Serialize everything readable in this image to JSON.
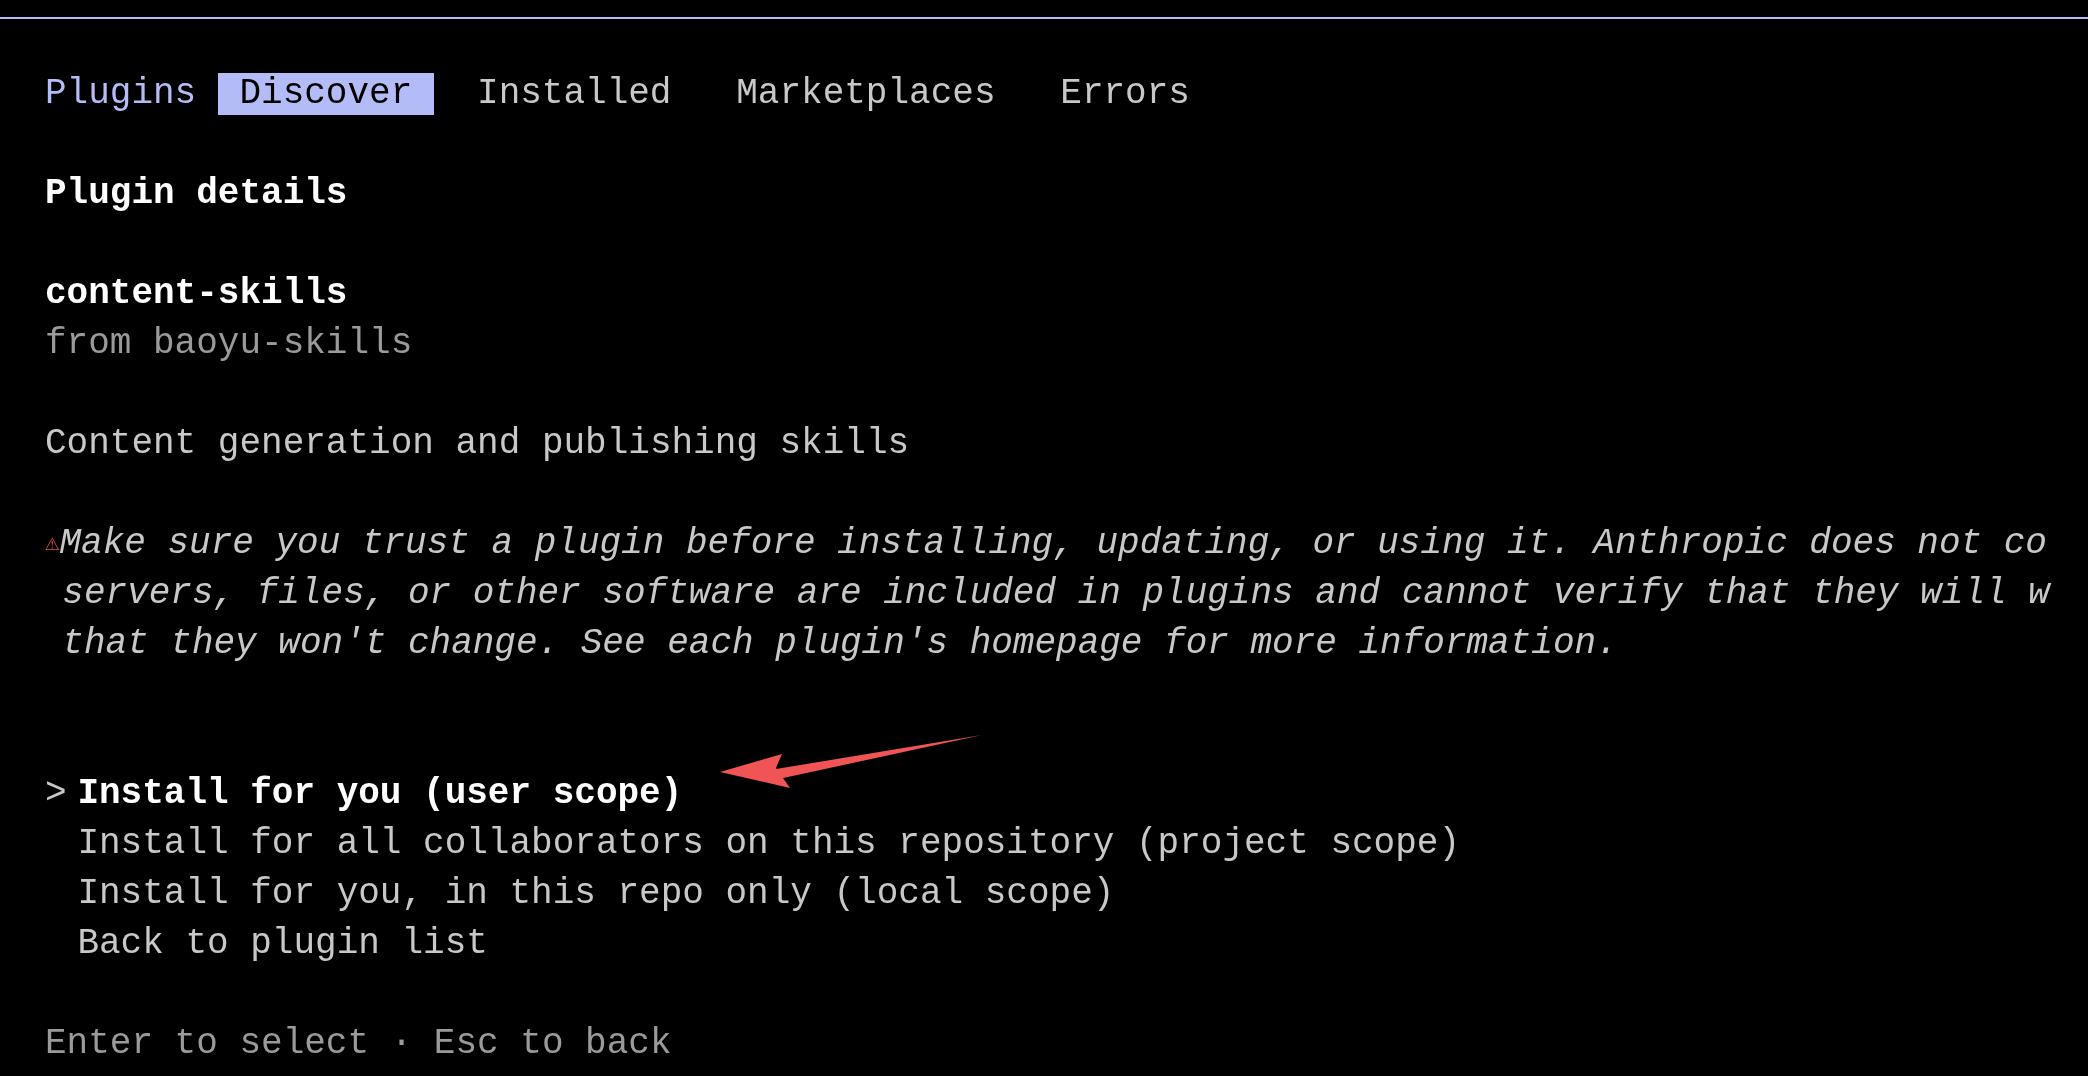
{
  "header": {
    "title": "Plugins"
  },
  "tabs": [
    {
      "label": "Discover",
      "selected": true
    },
    {
      "label": "Installed",
      "selected": false
    },
    {
      "label": "Marketplaces",
      "selected": false
    },
    {
      "label": "Errors",
      "selected": false
    }
  ],
  "section_title": "Plugin details",
  "plugin": {
    "name": "content-skills",
    "source": "from baoyu-skills",
    "description": "Content generation and publishing skills"
  },
  "warning": {
    "icon": "⚠",
    "lines": [
      "Make sure you trust a plugin before installing, updating, or using it. Anthropic does not co",
      "servers, files, or other software are included in plugins and cannot verify that they will w",
      "that they won't change. See each plugin's homepage for more information."
    ]
  },
  "pointer": ">",
  "options": [
    {
      "label": "Install for you (user scope)",
      "selected": true
    },
    {
      "label": "Install for all collaborators on this repository (project scope)",
      "selected": false
    },
    {
      "label": "Install for you, in this repo only (local scope)",
      "selected": false
    },
    {
      "label": "Back to plugin list",
      "selected": false
    }
  ],
  "footer": "Enter to select · Esc to back"
}
